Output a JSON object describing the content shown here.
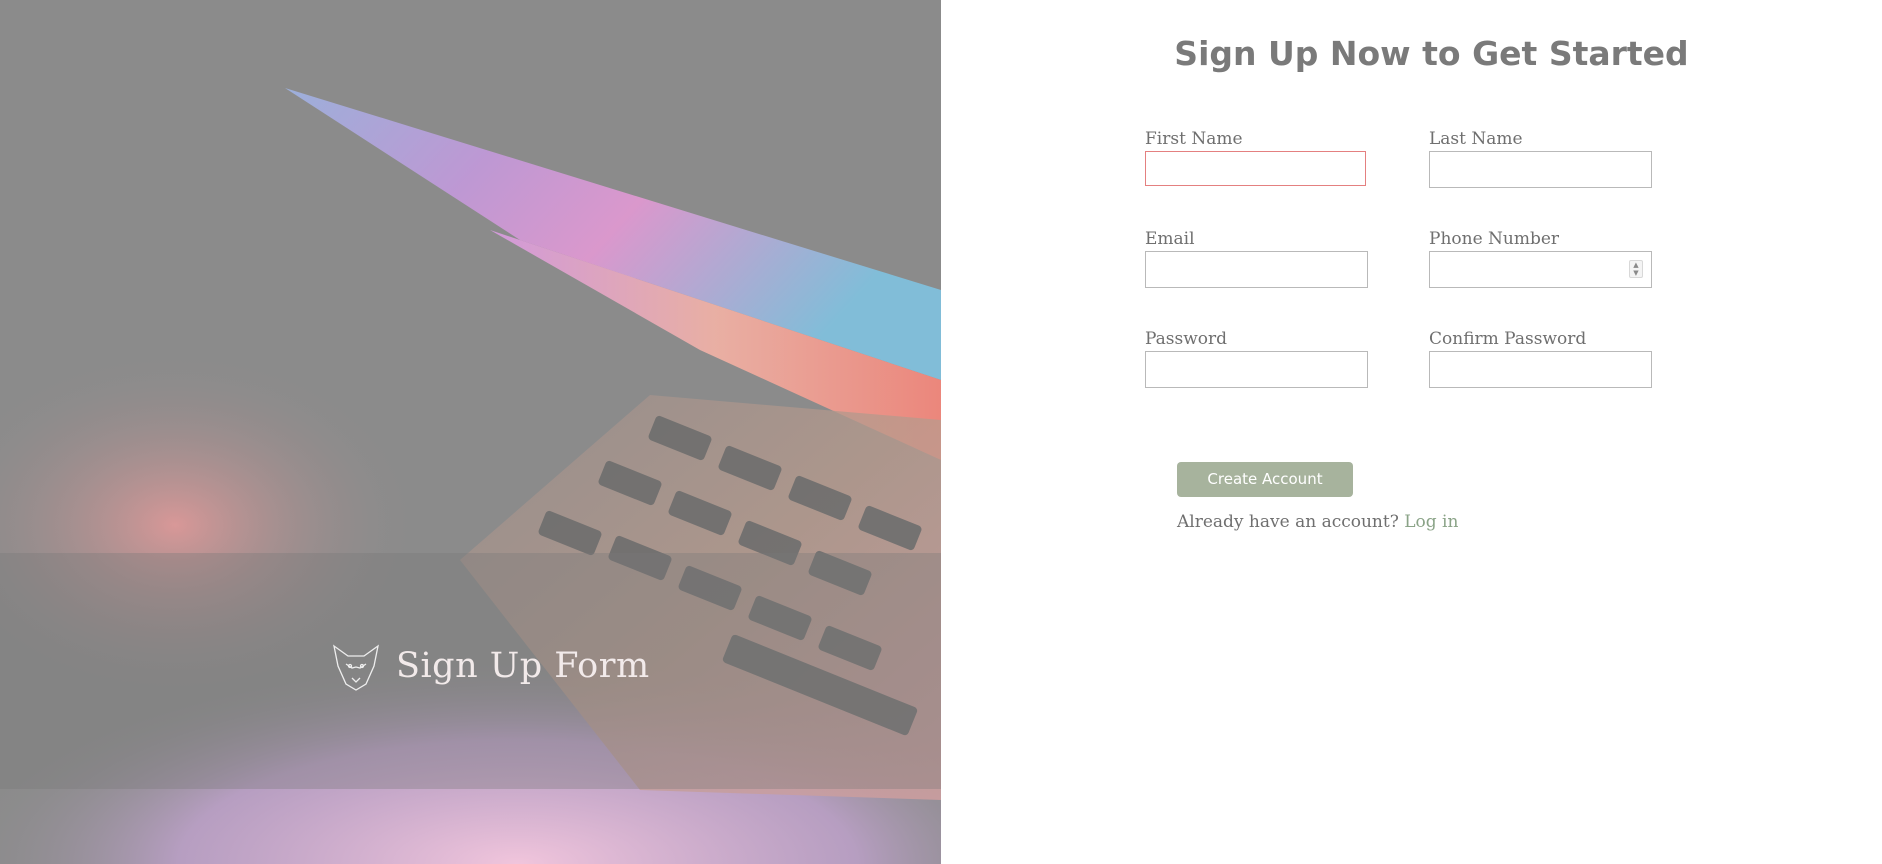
{
  "hero": {
    "title": "Sign Up Form",
    "logo_icon": "fox-head-icon"
  },
  "form": {
    "title": "Sign Up Now to Get Started",
    "fields": {
      "first_name": {
        "label": "First Name",
        "value": "",
        "state": "invalid"
      },
      "last_name": {
        "label": "Last Name",
        "value": ""
      },
      "email": {
        "label": "Email",
        "value": ""
      },
      "phone": {
        "label": "Phone Number",
        "value": "",
        "type": "number"
      },
      "password": {
        "label": "Password",
        "value": ""
      },
      "confirm_password": {
        "label": "Confirm Password",
        "value": ""
      }
    },
    "submit_label": "Create Account",
    "login_prompt": "Already have an account?",
    "login_link": "Log in"
  },
  "colors": {
    "accent_button": "#a7b39d",
    "link": "#8aa387",
    "invalid_border": "#e48080",
    "title_text": "#7a7a7a"
  }
}
